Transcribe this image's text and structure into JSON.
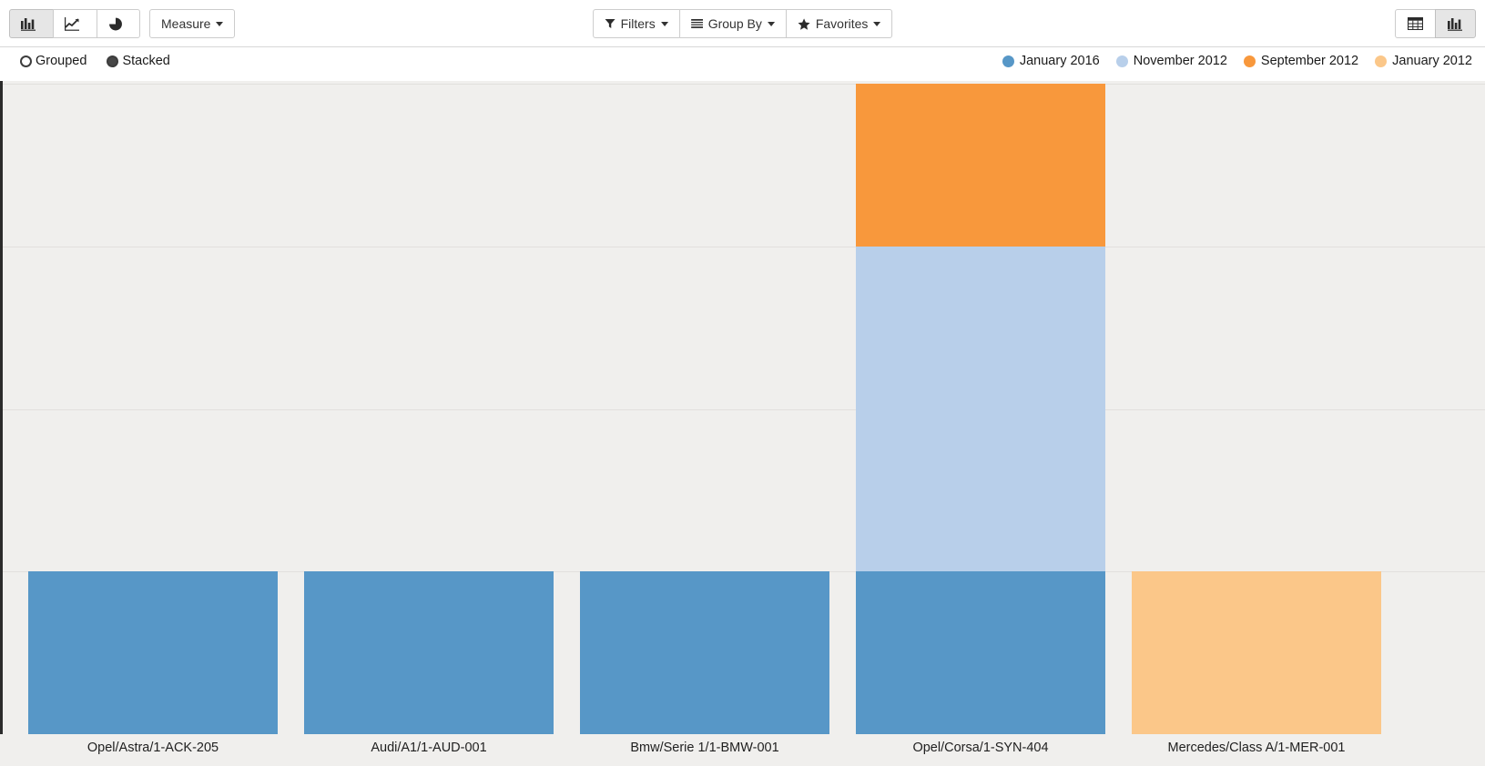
{
  "toolbar": {
    "view_buttons": [
      {
        "name": "bar-chart",
        "icon": "bar-chart-icon",
        "active": true
      },
      {
        "name": "line-chart",
        "icon": "line-chart-icon",
        "active": false
      },
      {
        "name": "pie-chart",
        "icon": "pie-chart-icon",
        "active": false
      }
    ],
    "measure_label": "Measure",
    "filters_label": "Filters",
    "group_by_label": "Group By",
    "favorites_label": "Favorites",
    "switch_buttons": [
      {
        "name": "list-view",
        "icon": "table-grid-icon",
        "active": false
      },
      {
        "name": "graph-view",
        "icon": "bar-chart-icon",
        "active": true
      }
    ]
  },
  "chart_modes": [
    {
      "label": "Grouped",
      "selected": false
    },
    {
      "label": "Stacked",
      "selected": true
    }
  ],
  "colors": {
    "series_january_2016": "#5797c7",
    "series_november_2012": "#b8cfea",
    "series_september_2012": "#f8983c",
    "series_january_2012": "#fbc789",
    "plot_background": "#f0efed",
    "axis": "#2b2b2b",
    "gridline": "#e2e0dd"
  },
  "chart_data": {
    "type": "bar",
    "stacked": true,
    "title": "",
    "xlabel": "",
    "ylabel": "",
    "grid": true,
    "legend_position": "top-right",
    "categories": [
      "Opel/Astra/1-ACK-205",
      "Audi/A1/1-AUD-001",
      "Bmw/Serie 1/1-BMW-001",
      "Opel/Corsa/1-SYN-404",
      "Mercedes/Class A/1-MER-001"
    ],
    "series": [
      {
        "name": "January 2016",
        "color": "#5797c7",
        "values": [
          1,
          1,
          1,
          1,
          0
        ]
      },
      {
        "name": "November 2012",
        "color": "#b8cfea",
        "values": [
          0,
          0,
          0,
          2,
          0
        ]
      },
      {
        "name": "September 2012",
        "color": "#f8983c",
        "values": [
          0,
          0,
          0,
          1,
          0
        ]
      },
      {
        "name": "January 2012",
        "color": "#fbc789",
        "values": [
          0,
          0,
          0,
          0,
          1
        ]
      }
    ],
    "ylim": [
      0,
      4
    ],
    "yticks": [
      1,
      2,
      3,
      4
    ]
  }
}
